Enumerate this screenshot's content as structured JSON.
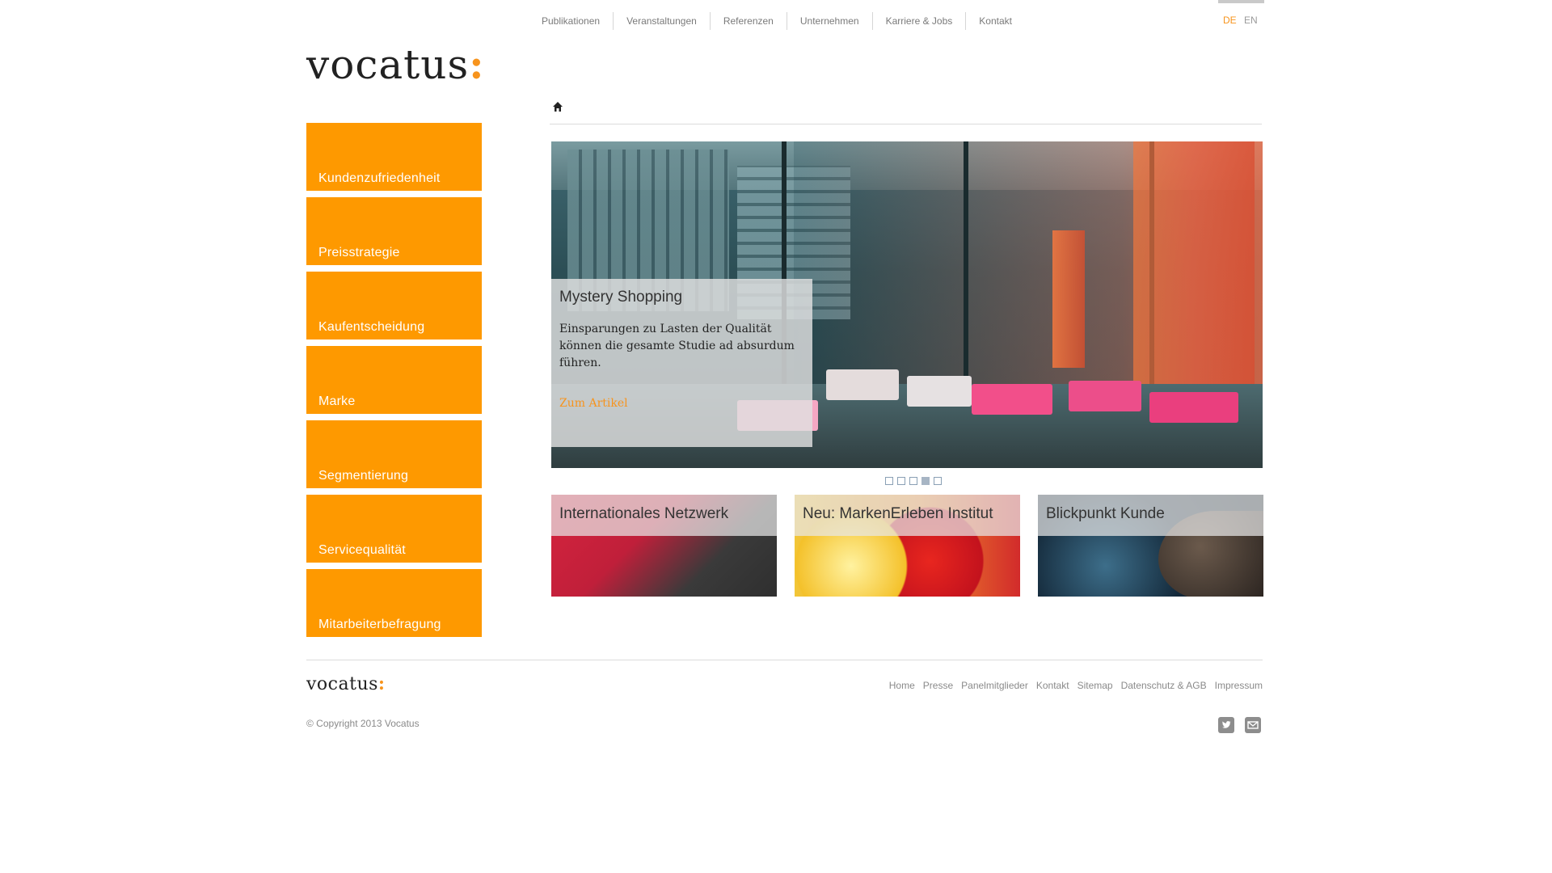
{
  "topnav": {
    "items": [
      "Publikationen",
      "Veranstaltungen",
      "Referenzen",
      "Unternehmen",
      "Karriere & Jobs",
      "Kontakt"
    ]
  },
  "lang": {
    "de": "DE",
    "en": "EN"
  },
  "logo": {
    "text": "vocatus",
    "colon": ":"
  },
  "breadcrumb": {
    "icon": "home-icon"
  },
  "sidebar": {
    "items": [
      "Kundenzufriedenheit",
      "Preisstrategie",
      "Kaufentscheidung",
      "Marke",
      "Segmentierung",
      "Servicequalität",
      "Mitarbeiterbefragung"
    ],
    "color": "#fe9900"
  },
  "hero": {
    "title": "Mystery Shopping",
    "text": "Einsparungen zu Lasten der Qualität können die gesamte Studie ad absurdum führen.",
    "link": "Zum Artikel"
  },
  "slider": {
    "total": 5,
    "active": 4
  },
  "teasers": [
    {
      "label": "Internationales Netzwerk"
    },
    {
      "label": "Neu: MarkenErleben Institut"
    },
    {
      "label": "Blickpunkt Kunde"
    }
  ],
  "footer": {
    "logo_text": "vocatus",
    "links": [
      "Home",
      "Presse",
      "Panelmitglieder",
      "Kontakt",
      "Sitemap",
      "Datenschutz & AGB",
      "Impressum"
    ],
    "copyright": "© Copyright 2013 Vocatus",
    "icons": [
      "twitter-icon",
      "mail-icon"
    ]
  },
  "accent": "#f7941d"
}
